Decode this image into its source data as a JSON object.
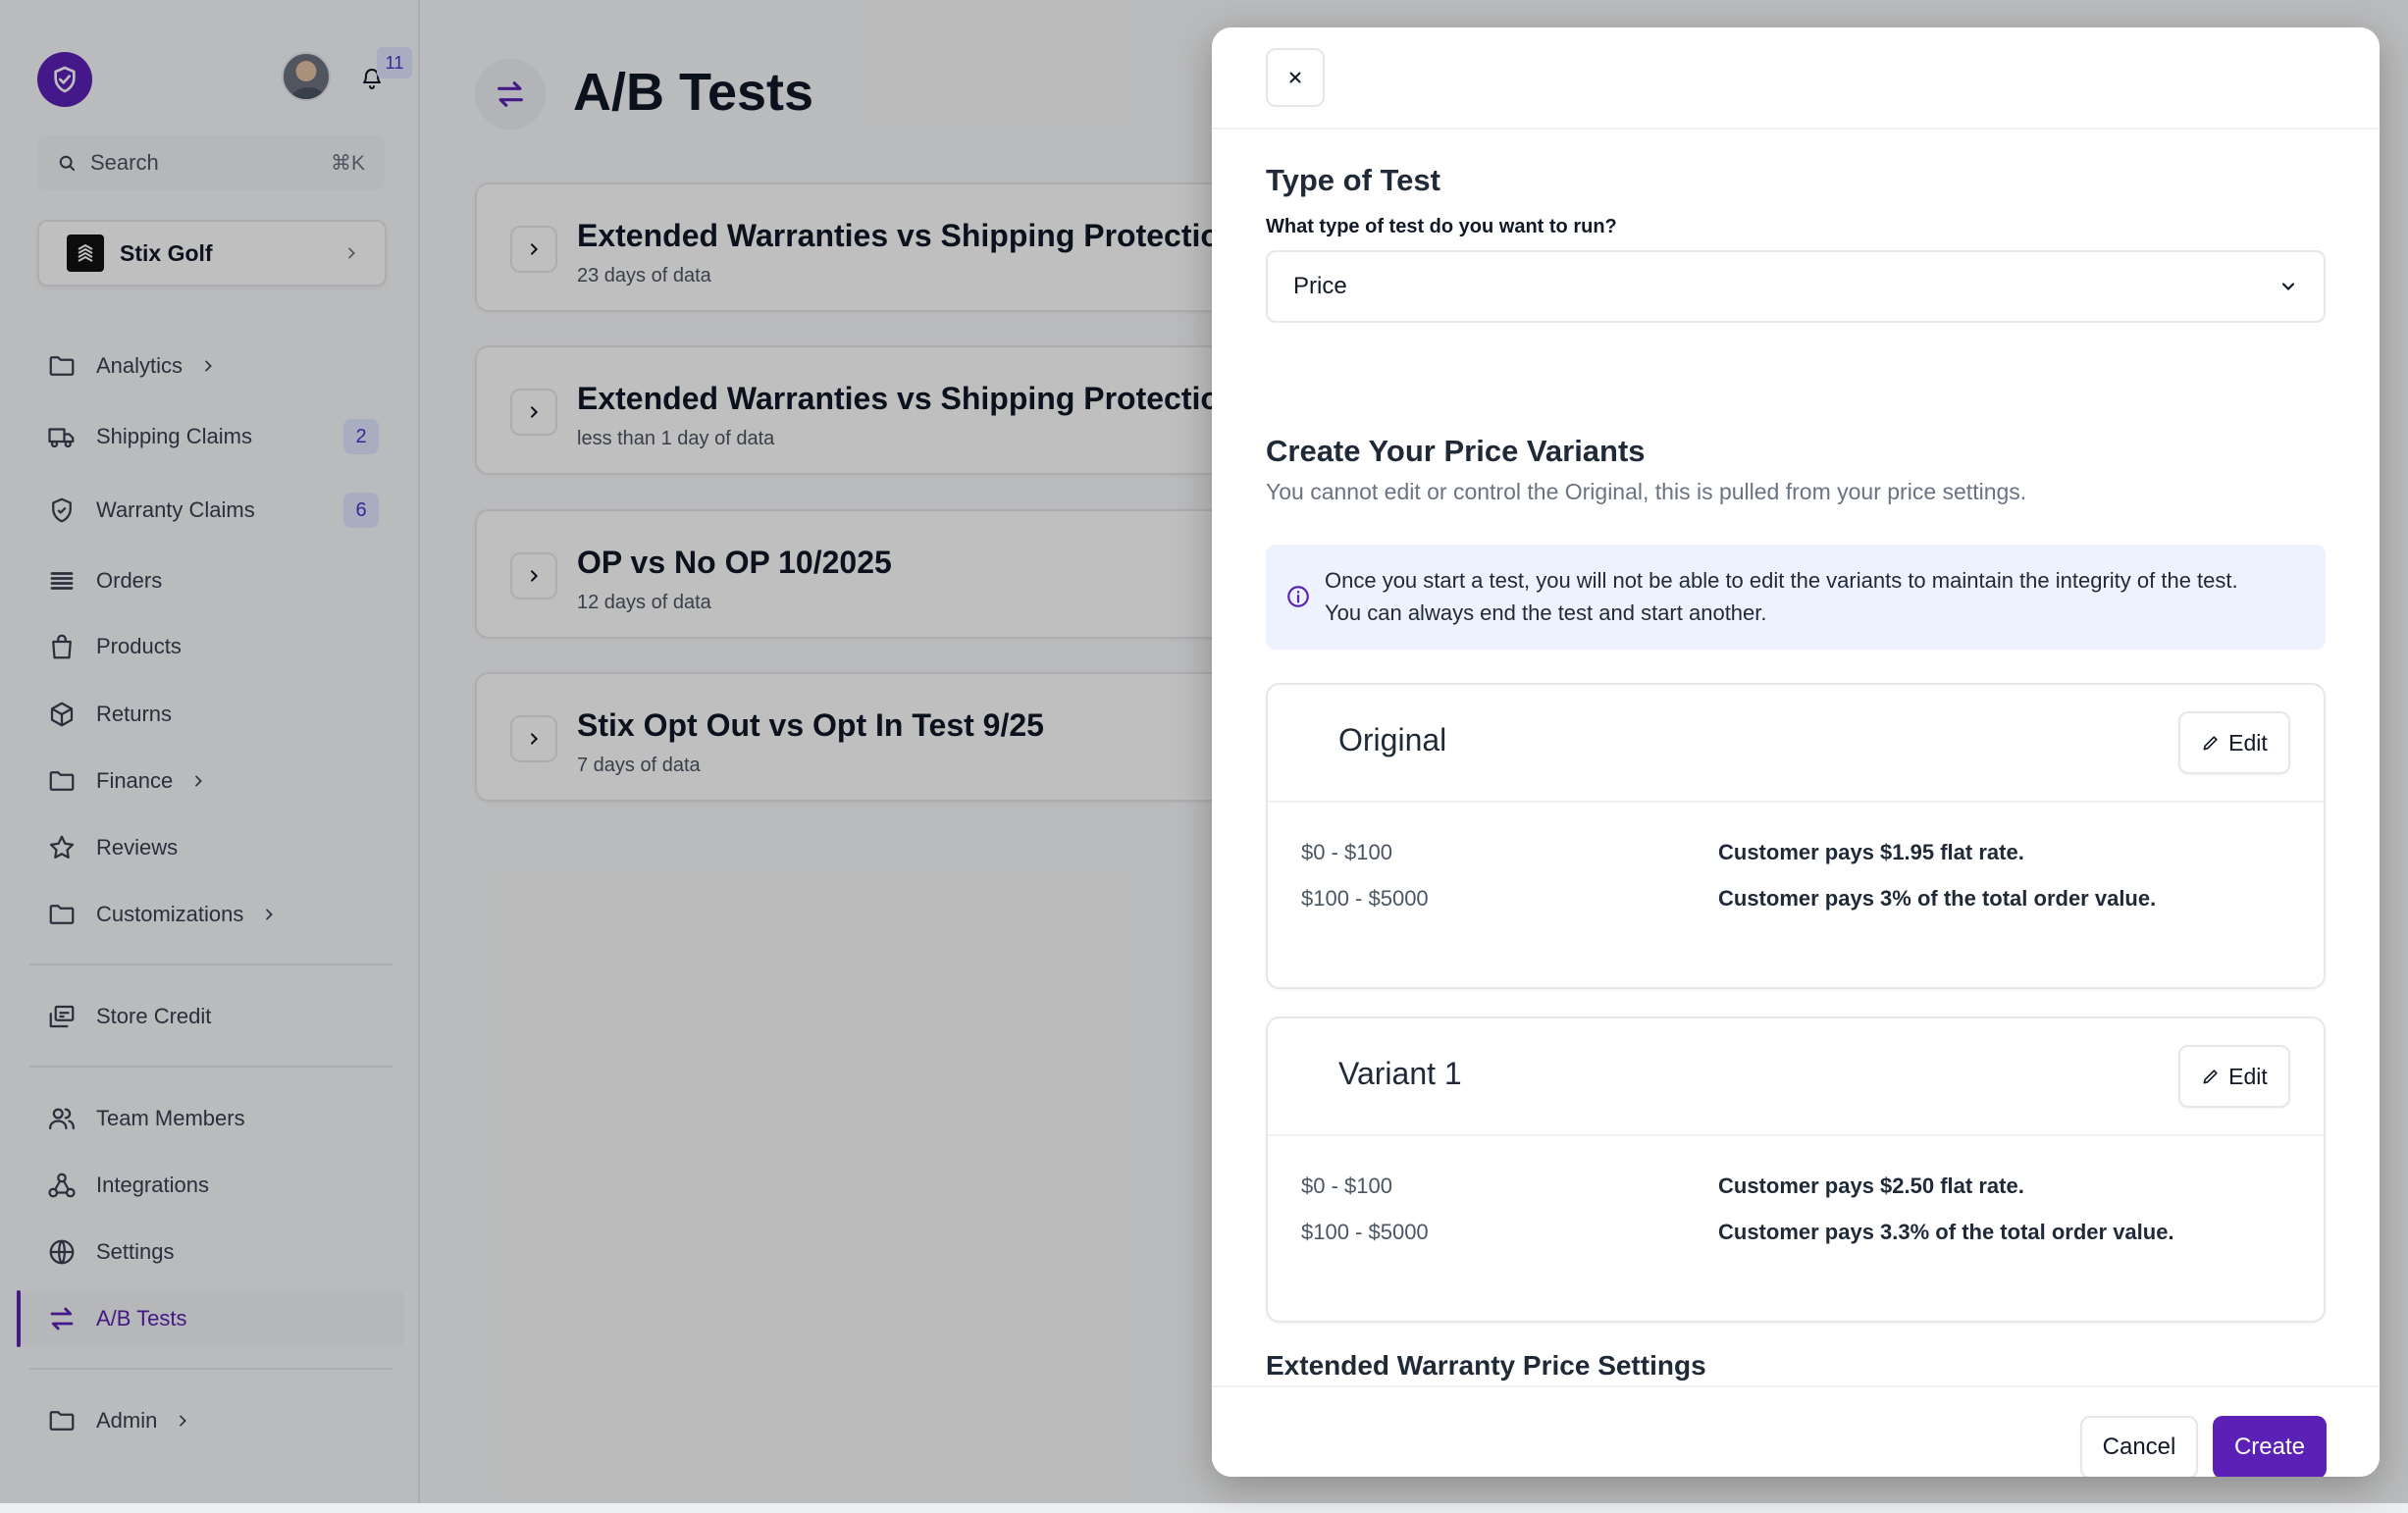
{
  "colors": {
    "accent": "#5b21b6",
    "badge_bg": "#e0e7ff",
    "badge_text": "#4338ca",
    "info_bg": "#eef2ff"
  },
  "sidebar": {
    "notifications_count": "11",
    "search": {
      "placeholder": "Search",
      "shortcut": "⌘K"
    },
    "store": {
      "name": "Stix Golf"
    },
    "items": [
      {
        "label": "Analytics",
        "icon": "folder-icon",
        "has_chevron": true
      },
      {
        "label": "Shipping Claims",
        "icon": "truck-icon",
        "badge": "2"
      },
      {
        "label": "Warranty Claims",
        "icon": "shield-icon",
        "badge": "6"
      },
      {
        "label": "Orders",
        "icon": "stack-icon"
      },
      {
        "label": "Products",
        "icon": "bag-icon"
      },
      {
        "label": "Returns",
        "icon": "box-icon"
      },
      {
        "label": "Finance",
        "icon": "folder-icon",
        "has_chevron": true
      },
      {
        "label": "Reviews",
        "icon": "star-icon"
      },
      {
        "label": "Customizations",
        "icon": "folder-icon",
        "has_chevron": true
      },
      {
        "label": "Store Credit",
        "icon": "credit-icon"
      },
      {
        "label": "Team Members",
        "icon": "users-icon"
      },
      {
        "label": "Integrations",
        "icon": "webhook-icon"
      },
      {
        "label": "Settings",
        "icon": "globe-icon"
      },
      {
        "label": "A/B Tests",
        "icon": "swap-icon",
        "active": true
      },
      {
        "label": "Admin",
        "icon": "folder-icon",
        "has_chevron": true
      }
    ]
  },
  "main": {
    "title": "A/B Tests",
    "tests": [
      {
        "title": "Extended Warranties vs Shipping Protection",
        "subtitle": "23 days of data"
      },
      {
        "title": "Extended Warranties vs Shipping Protection",
        "subtitle": "less than 1 day of data"
      },
      {
        "title": "OP vs No OP 10/2025",
        "subtitle": "12 days of data"
      },
      {
        "title": "Stix Opt Out vs Opt In Test 9/25",
        "subtitle": "7 days of data"
      }
    ]
  },
  "modal": {
    "type_section": {
      "title": "Type of Test",
      "question": "What type of test do you want to run?",
      "selected": "Price"
    },
    "variants_section": {
      "title": "Create Your Price Variants",
      "description": "You cannot edit or control the Original, this is pulled from your price settings.",
      "info_line1": "Once you start a test, you will not be able to edit the variants to maintain the integrity of the test.",
      "info_line2": "You can always end the test and start another."
    },
    "variants": [
      {
        "name": "Original",
        "edit_label": "Edit",
        "tiers": [
          {
            "range": "$0 - $100",
            "description": "Customer pays $1.95 flat rate."
          },
          {
            "range": "$100 - $5000",
            "description": "Customer pays 3% of the total order value."
          }
        ]
      },
      {
        "name": "Variant 1",
        "edit_label": "Edit",
        "tiers": [
          {
            "range": "$0 - $100",
            "description": "Customer pays $2.50 flat rate."
          },
          {
            "range": "$100 - $5000",
            "description": "Customer pays 3.3% of the total order value."
          }
        ]
      }
    ],
    "warranty_section": {
      "title": "Extended Warranty Price Settings"
    },
    "footer": {
      "cancel_label": "Cancel",
      "create_label": "Create"
    }
  }
}
